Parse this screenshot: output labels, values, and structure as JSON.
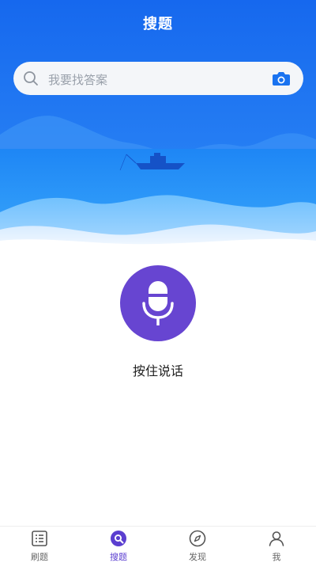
{
  "header": {
    "title": "搜题"
  },
  "search": {
    "placeholder": "我要找答案",
    "icon": "search-icon",
    "camera_icon": "camera-icon"
  },
  "voice": {
    "label": "按住说话",
    "icon": "microphone-icon"
  },
  "tabbar": {
    "items": [
      {
        "label": "刷题",
        "icon": "list-icon",
        "active": false
      },
      {
        "label": "搜题",
        "icon": "search-bubble-icon",
        "active": true
      },
      {
        "label": "发现",
        "icon": "compass-icon",
        "active": false
      },
      {
        "label": "我",
        "icon": "user-icon",
        "active": false
      }
    ]
  },
  "colors": {
    "primary_blue": "#1a73f0",
    "accent_purple": "#6745d1",
    "active_tab": "#5b3fd0"
  }
}
